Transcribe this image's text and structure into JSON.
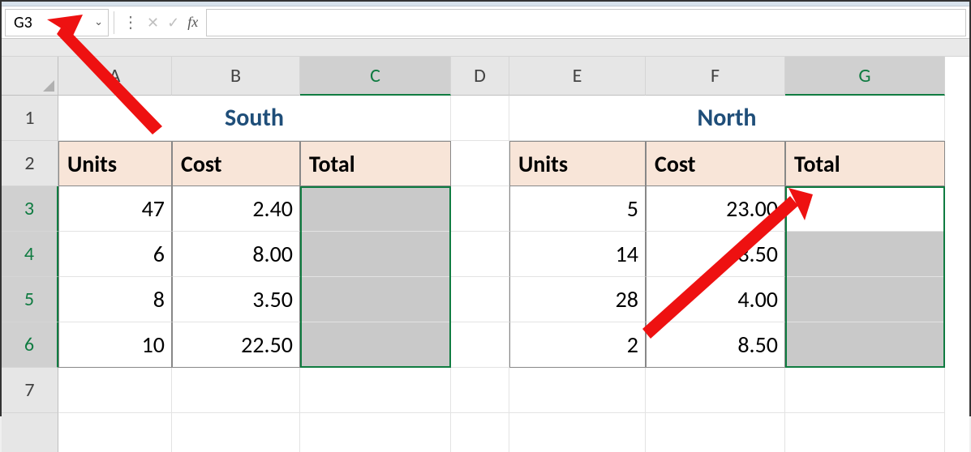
{
  "name_box": {
    "value": "G3"
  },
  "formula_bar": {
    "value": ""
  },
  "columns": [
    "A",
    "B",
    "C",
    "D",
    "E",
    "F",
    "G"
  ],
  "rows": [
    "1",
    "2",
    "3",
    "4",
    "5",
    "6",
    "7"
  ],
  "selected_columns": [
    "C",
    "G"
  ],
  "selected_rows": [
    "3",
    "4",
    "5",
    "6"
  ],
  "active_cell": "G3",
  "regions": {
    "south": {
      "title": "South",
      "headers": [
        "Units",
        "Cost",
        "Total"
      ],
      "data": [
        {
          "units": "47",
          "cost": "2.40",
          "total": ""
        },
        {
          "units": "6",
          "cost": "8.00",
          "total": ""
        },
        {
          "units": "8",
          "cost": "3.50",
          "total": ""
        },
        {
          "units": "10",
          "cost": "22.50",
          "total": ""
        }
      ]
    },
    "north": {
      "title": "North",
      "headers": [
        "Units",
        "Cost",
        "Total"
      ],
      "data": [
        {
          "units": "5",
          "cost": "23.00",
          "total": ""
        },
        {
          "units": "14",
          "cost": "3.50",
          "total": ""
        },
        {
          "units": "28",
          "cost": "4.00",
          "total": ""
        },
        {
          "units": "2",
          "cost": "8.50",
          "total": ""
        }
      ]
    }
  }
}
